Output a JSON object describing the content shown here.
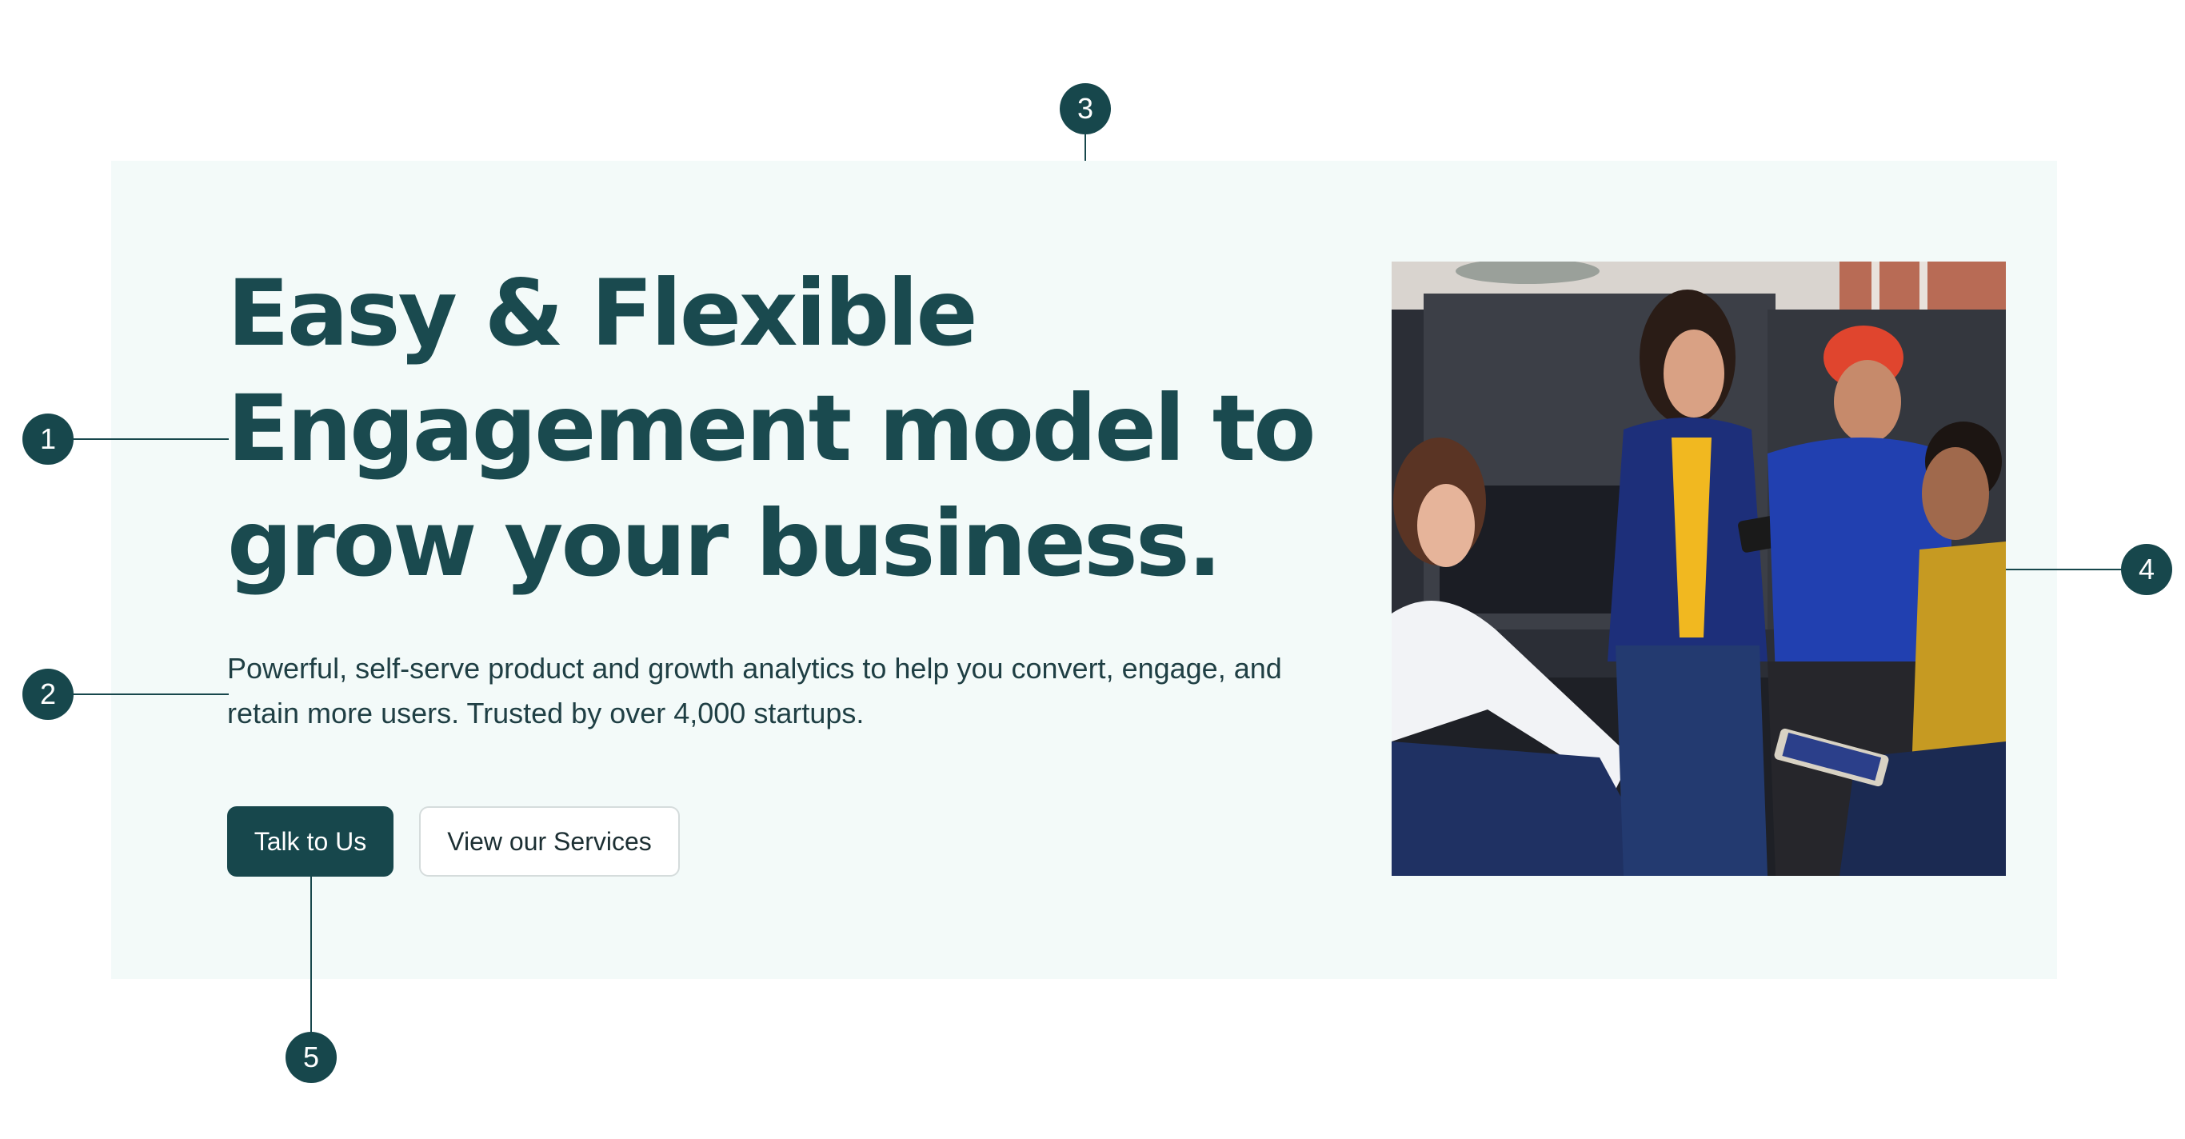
{
  "hero": {
    "headline_lines": [
      "Easy & Flexible",
      "Engagement model to",
      "grow your business."
    ],
    "subtext_lines": [
      "Powerful, self-serve product and growth analytics to help you convert, engage, and",
      "retain more users. Trusted by over 4,000 startups."
    ],
    "primary_button": "Talk to Us",
    "secondary_button": "View our Services",
    "photo_icon": "team-photo-icon"
  },
  "annotations": {
    "m1": "1",
    "m2": "2",
    "m3": "3",
    "m4": "4",
    "m5": "5"
  },
  "colors": {
    "brand": "#17474c",
    "hero_bg": "#f3faf9",
    "headline": "#1a4a4f"
  }
}
